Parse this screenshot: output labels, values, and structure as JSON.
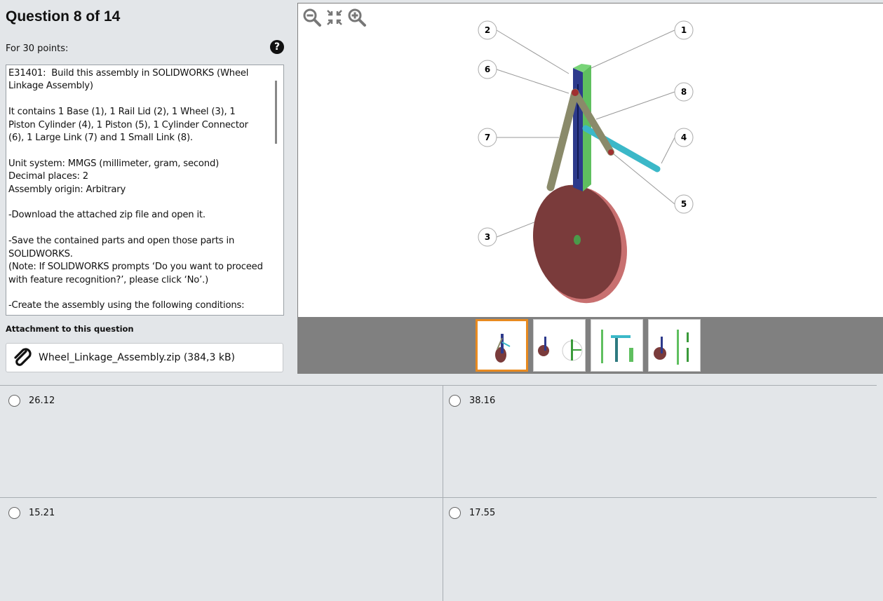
{
  "question": {
    "title": "Question 8 of 14",
    "points": "For 30 points:",
    "description": "E31401:  Build this assembly in SOLIDWORKS (Wheel Linkage Assembly)\n\nIt contains 1 Base (1), 1 Rail Lid (2), 1 Wheel (3), 1 Piston Cylinder (4), 1 Piston (5), 1 Cylinder Connector (6), 1 Large Link (7) and 1 Small Link (8).\n\nUnit system: MMGS (millimeter, gram, second)\nDecimal places: 2\nAssembly origin: Arbitrary\n\n-Download the attached zip file and open it.\n\n-Save the contained parts and open those parts in SOLIDWORKS.\n(Note: If SOLIDWORKS prompts ‘Do you want to proceed with feature recognition?’, please click ‘No’.)\n\n-Create the assembly using the following conditions:"
  },
  "attachment": {
    "label": "Attachment to this question",
    "file": "Wheel_Linkage_Assembly.zip (384,3 kB)"
  },
  "callouts": [
    "1",
    "2",
    "3",
    "4",
    "5",
    "6",
    "7",
    "8"
  ],
  "answers": [
    {
      "label": "26.12"
    },
    {
      "label": "38.16"
    },
    {
      "label": "15.21"
    },
    {
      "label": "17.55"
    }
  ],
  "colors": {
    "accent": "#e88a1f",
    "wheel": "#7a3b3b",
    "rail": "#2d3a8c",
    "base": "#5fbf5f",
    "piston": "#3bb8c8",
    "link": "#8a8a6a"
  }
}
